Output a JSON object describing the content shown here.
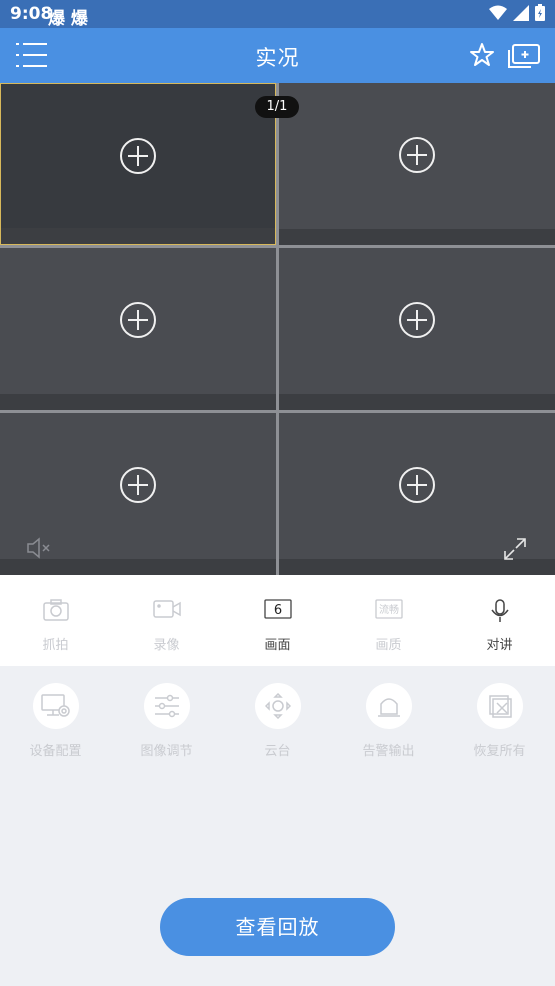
{
  "status_bar": {
    "time": "9:08",
    "notif": "爆 爆"
  },
  "header": {
    "title": "实况"
  },
  "grid": {
    "page_indicator": "1/1"
  },
  "toolbar": [
    {
      "label": "抓拍",
      "icon": "camera-icon",
      "active": false
    },
    {
      "label": "录像",
      "icon": "video-record-icon",
      "active": false
    },
    {
      "label": "画面",
      "icon": "split-screen-icon",
      "active": true,
      "value": "6"
    },
    {
      "label": "画质",
      "icon": "quality-icon",
      "active": false,
      "value": "流畅"
    },
    {
      "label": "对讲",
      "icon": "microphone-icon",
      "active": true
    }
  ],
  "actions": [
    {
      "label": "设备配置",
      "icon": "device-config-icon"
    },
    {
      "label": "图像调节",
      "icon": "image-adjust-icon"
    },
    {
      "label": "云台",
      "icon": "ptz-icon"
    },
    {
      "label": "告警输出",
      "icon": "alarm-icon"
    },
    {
      "label": "恢复所有",
      "icon": "restore-icon"
    }
  ],
  "playback_button": {
    "label": "查看回放"
  },
  "colors": {
    "primary": "#4a90e2",
    "statusbar": "#3a6fb6",
    "active_border": "#d7b85b"
  }
}
